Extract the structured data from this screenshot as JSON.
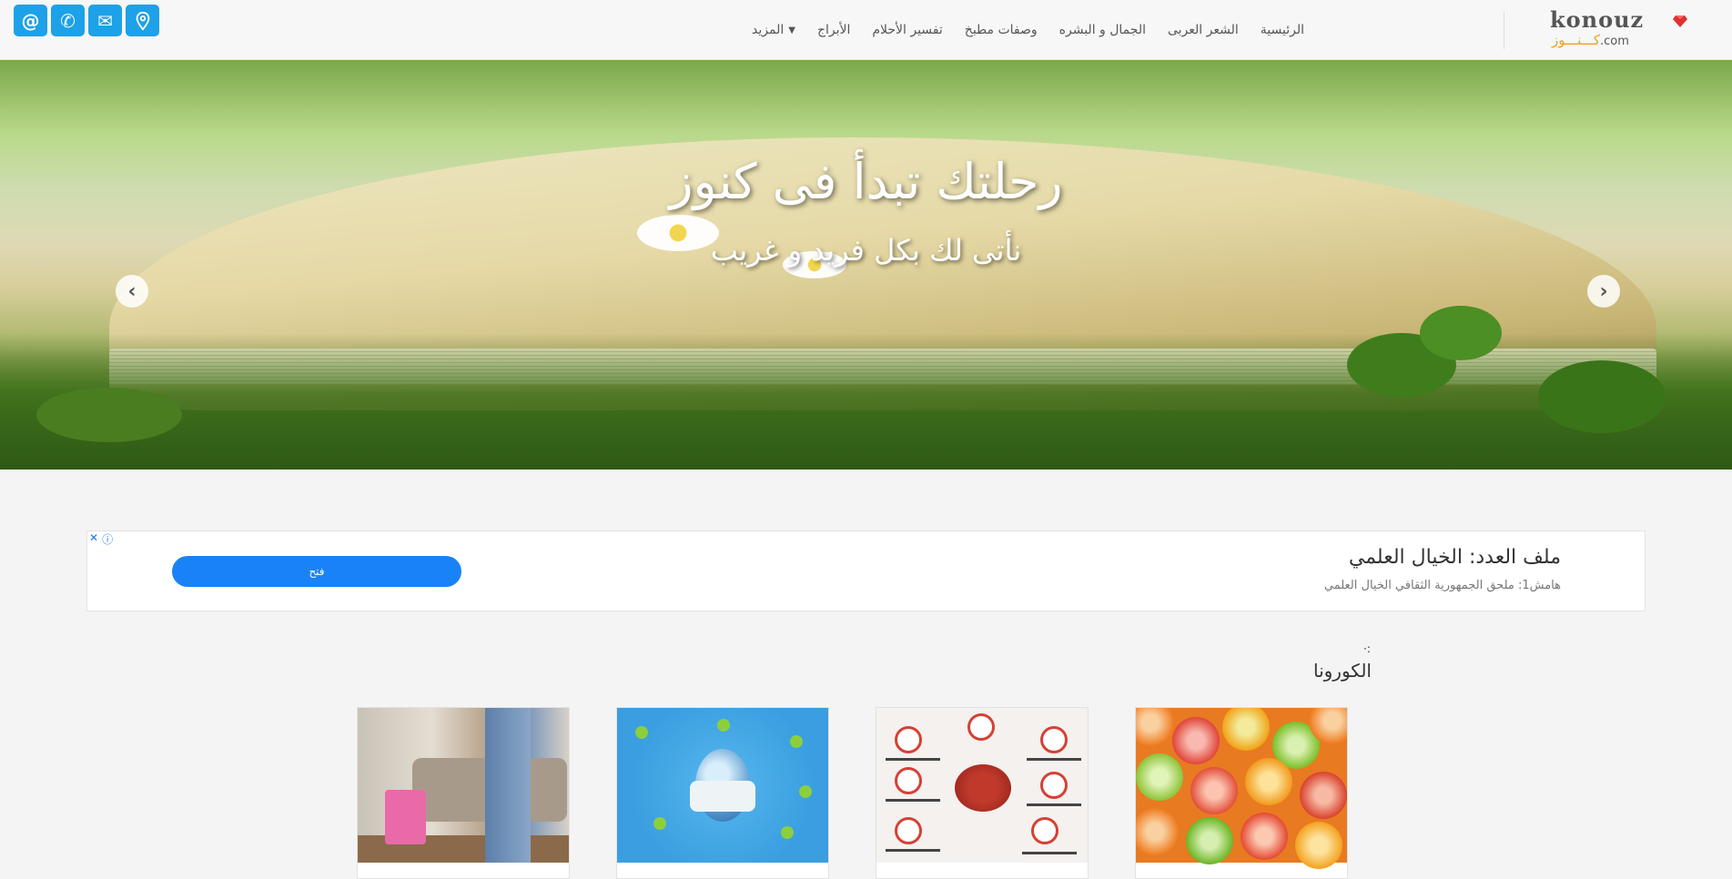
{
  "header": {
    "social": [
      {
        "name": "at",
        "glyph": "@"
      },
      {
        "name": "phone",
        "glyph": "✆"
      },
      {
        "name": "mail",
        "glyph": "✉"
      },
      {
        "name": "location",
        "glyph": "⌖"
      }
    ],
    "nav": [
      {
        "label": "الرئيسية"
      },
      {
        "label": "الشعر العربى"
      },
      {
        "label": "الجمال و البشره"
      },
      {
        "label": "وصفات مطبخ"
      },
      {
        "label": "تفسير الأحلام"
      },
      {
        "label": "الأبراج"
      }
    ],
    "more_label": "المزيد",
    "logo": {
      "brand": "konouz",
      "arabic": "كـــنـــوز",
      "com": ".com"
    }
  },
  "hero": {
    "title": "رحلتك تبدأ فى كنوز",
    "subtitle": "نأتى لك بكل فريد و غريب",
    "prev_glyph": "‹",
    "next_glyph": "›"
  },
  "ad": {
    "title": "ملف العدد: الخيال العلمي",
    "text": "هامش1: ملحق الجمهورية الثقافي الخيال العلمي",
    "button": "فتح",
    "close": "✕",
    "info": "ⓘ"
  },
  "section": {
    "mark": "·:",
    "title": "الكورونا"
  },
  "colors": {
    "accent": "#1da1e8",
    "ad_button": "#1a82f7",
    "logo_orange": "#e8a020"
  }
}
